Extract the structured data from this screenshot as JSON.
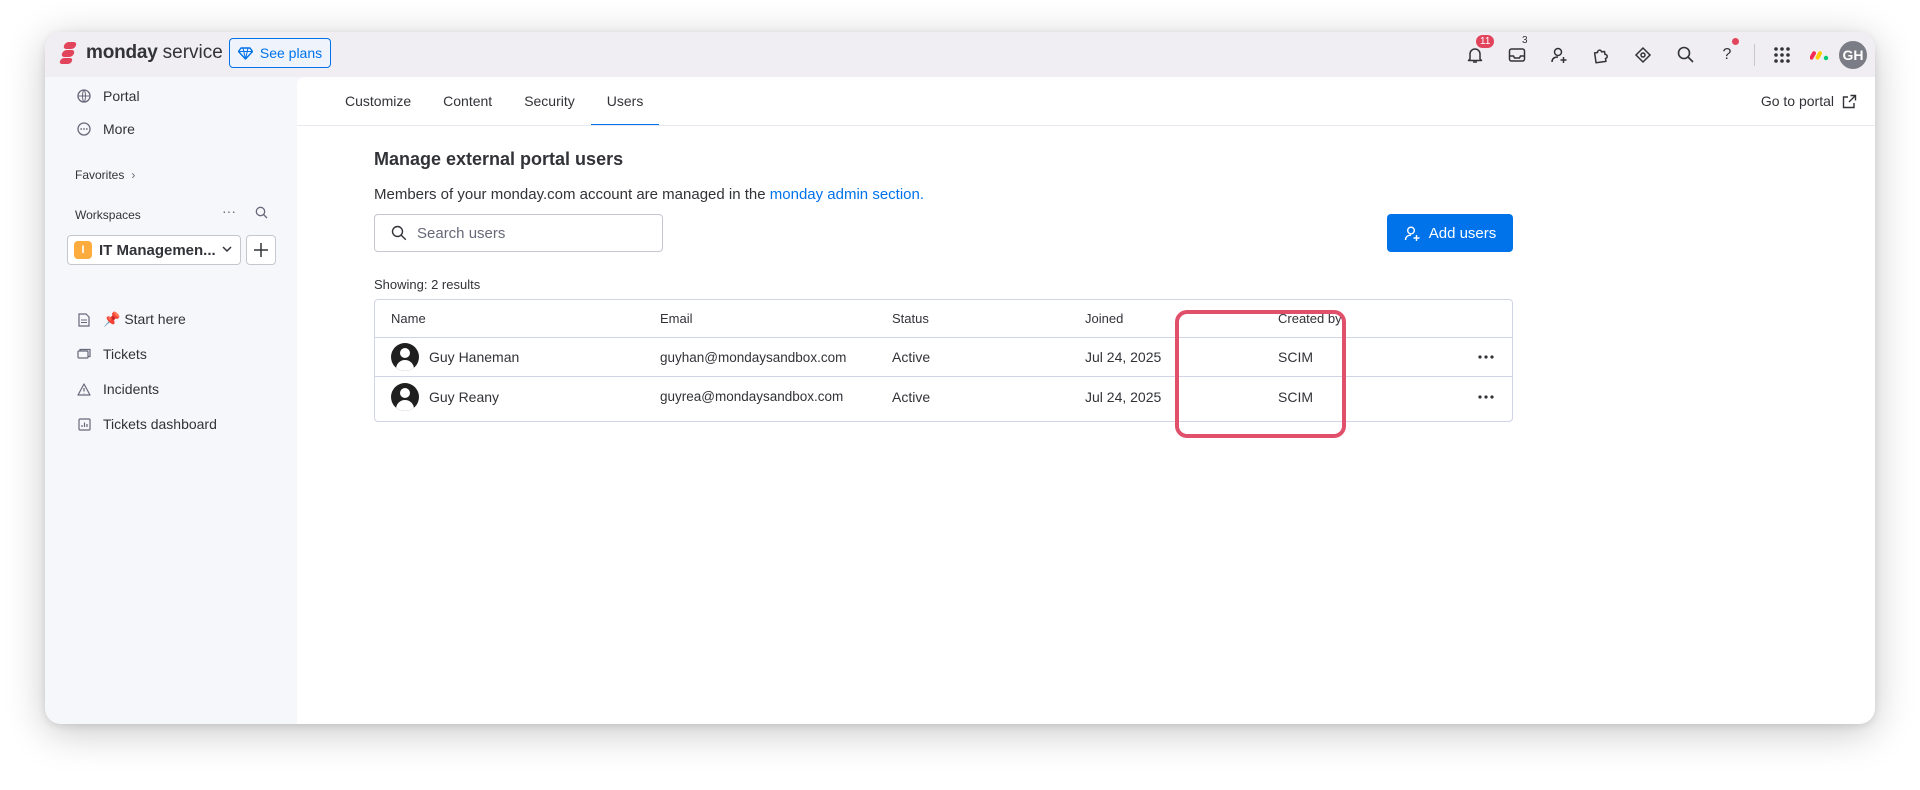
{
  "app": {
    "brand_bold": "monday",
    "brand_light": "service",
    "see_plans": "See plans",
    "notifications_count": "11",
    "inbox_count": "3",
    "avatar_initials": "GH"
  },
  "sidebar": {
    "portal": "Portal",
    "more": "More",
    "favorites": "Favorites",
    "workspaces": "Workspaces",
    "workspace_badge": "I",
    "workspace_name": "IT Managemen...",
    "items": [
      {
        "label": "📌 Start here",
        "icon": "document-icon"
      },
      {
        "label": "Tickets",
        "icon": "tickets-icon"
      },
      {
        "label": "Incidents",
        "icon": "warning-icon"
      },
      {
        "label": "Tickets dashboard",
        "icon": "dashboard-icon"
      }
    ]
  },
  "tabs": [
    "Customize",
    "Content",
    "Security",
    "Users"
  ],
  "active_tab": "Users",
  "go_to_portal": "Go to portal",
  "page": {
    "title": "Manage external portal users",
    "subtitle_prefix": "Members of your monday.com account are managed in the ",
    "subtitle_link": "monday admin section.",
    "search_placeholder": "Search users",
    "add_users": "Add users",
    "showing": "Showing: 2 results"
  },
  "table": {
    "headers": {
      "name": "Name",
      "email": "Email",
      "status": "Status",
      "joined": "Joined",
      "created_by": "Created by"
    },
    "rows": [
      {
        "name": "Guy Haneman",
        "email": "guyhan@mondaysandbox.com",
        "status": "Active",
        "joined": "Jul 24, 2025",
        "created_by": "SCIM"
      },
      {
        "name": "Guy Reany",
        "email": "guyrea@mondaysandbox.com",
        "status": "Active",
        "joined": "Jul 24, 2025",
        "created_by": "SCIM"
      }
    ]
  },
  "colors": {
    "primary": "#0073ea",
    "highlight": "#e0506a",
    "brand_red": "#e2445c",
    "workspace_badge": "#fdab3d"
  }
}
